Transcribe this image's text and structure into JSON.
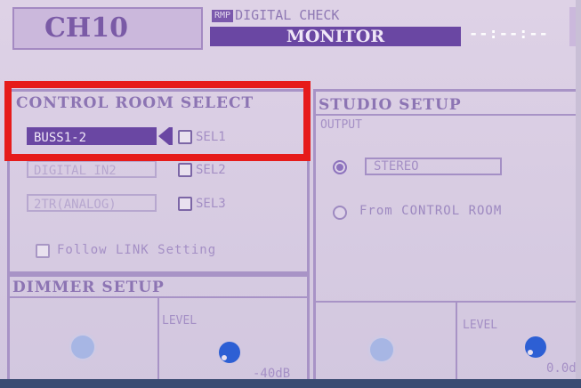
{
  "header": {
    "channel": "CH10",
    "tag": "RMP",
    "mode_text": "DIGITAL CHECK",
    "page_title": "MONITOR",
    "time": "--:--:--"
  },
  "control_room": {
    "title": "CONTROL ROOM SELECT",
    "sources": [
      {
        "label": "BUSS1-2",
        "select": "SEL1",
        "active": true
      },
      {
        "label": "DIGITAL IN2",
        "select": "SEL2",
        "active": false
      },
      {
        "label": "2TR(ANALOG)",
        "select": "SEL3",
        "active": false
      }
    ],
    "follow_link": "Follow LINK Setting"
  },
  "studio": {
    "title": "STUDIO SETUP",
    "output_label": "OUTPUT",
    "options": [
      {
        "label": "STEREO",
        "selected": true
      },
      {
        "label": "From CONTROL ROOM",
        "selected": false
      }
    ],
    "level_label": "LEVEL",
    "level_value": "0.0d"
  },
  "dimmer": {
    "title": "DIMMER SETUP",
    "level_label": "LEVEL",
    "level_value": "-40dB"
  },
  "colors": {
    "accent": "#6a47a3",
    "highlight": "#e61b1b",
    "knob": "#2d5fd4"
  }
}
